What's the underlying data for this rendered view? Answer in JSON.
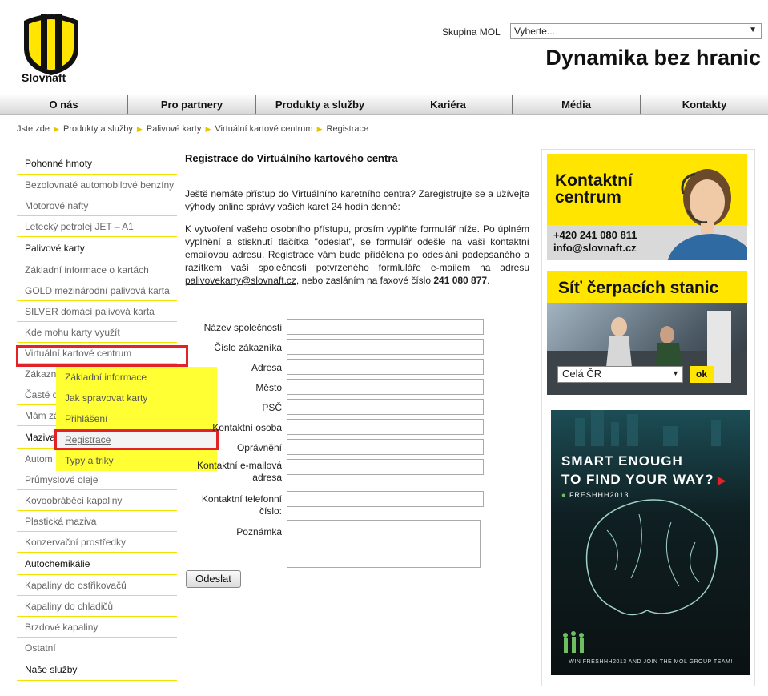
{
  "header": {
    "logo_text": "Slovnaft",
    "group_label": "Skupina MOL",
    "group_select_value": "Vyberte...",
    "slogan": "Dynamika bez hranic"
  },
  "topnav": [
    "O nás",
    "Pro partnery",
    "Produkty a služby",
    "Kariéra",
    "Média",
    "Kontakty"
  ],
  "breadcrumb": [
    "Jste zde",
    "Produkty a služby",
    "Palivové karty",
    "Virtuální kartové centrum",
    "Registrace"
  ],
  "sidebar": [
    {
      "label": "Pohonné hmoty",
      "cat": true
    },
    {
      "label": "Bezolovnaté automobilové benzíny",
      "cat": false
    },
    {
      "label": "Motorové nafty",
      "cat": false
    },
    {
      "label": "Letecký petrolej JET – A1",
      "cat": false
    },
    {
      "label": "Palivové karty",
      "cat": true
    },
    {
      "label": "Základní informace o kartách",
      "cat": false
    },
    {
      "label": "GOLD mezinárodní palivová karta",
      "cat": false
    },
    {
      "label": "SILVER domácí palivová karta",
      "cat": false
    },
    {
      "label": "Kde mohu karty využít",
      "cat": false
    },
    {
      "label": "Virtuální kartové centrum",
      "cat": false
    },
    {
      "label": "Zákazn",
      "cat": false
    },
    {
      "label": "Časté d",
      "cat": false
    },
    {
      "label": "Mám zá",
      "cat": false
    },
    {
      "label": "Maziva",
      "cat": true
    },
    {
      "label": "Autom",
      "cat": false
    },
    {
      "label": "Průmyslové oleje",
      "cat": false
    },
    {
      "label": "Kovoobráběcí kapaliny",
      "cat": false
    },
    {
      "label": "Plastická maziva",
      "cat": false
    },
    {
      "label": "Konzervační prostředky",
      "cat": false
    },
    {
      "label": "Autochemikálie",
      "cat": true
    },
    {
      "label": "Kapaliny do ostřikovačů",
      "cat": false
    },
    {
      "label": "Kapaliny do chladičů",
      "cat": false
    },
    {
      "label": "Brzdové kapaliny",
      "cat": false
    },
    {
      "label": "Ostatní",
      "cat": false
    },
    {
      "label": "Naše služby",
      "cat": true
    }
  ],
  "flyout": [
    "Základní informace",
    "Jak spravovat karty",
    "Přihlášení",
    "Registrace",
    "Typy a triky"
  ],
  "main": {
    "title": "Registrace do Virtuálního kartového centra",
    "intro": "Ještě nemáte přístup do Virtuálního karetního centra? Zaregistrujte se a užívejte výhody online správy vašich karet 24 hodin denně:",
    "instr_1": "K vytvoření vašeho osobního přístupu, prosím vyplňte formulář níže. Po úplném vyplnění a stisknutí tlačítka \"odeslat\", se formulář odešle na vaši kontaktní emailovou adresu. Registrace vám bude přidělena po odeslání podepsaného a razítkem vaší společnosti potvrzeného formluláře e-mailem na adresu ",
    "email": "palivovekarty@slovnaft.cz",
    "instr_2": ", nebo zasláním na faxové číslo ",
    "fax": "241 080 877",
    "instr_3": "."
  },
  "form": {
    "company": "Název společnosti",
    "customer_no": "Číslo zákazníka",
    "address": "Adresa",
    "city": "Město",
    "zip": "PSČ",
    "contact_person": "Kontaktní osoba",
    "authorization": "Oprávnění",
    "email": "Kontaktní e-mailová adresa",
    "phone": "Kontaktní telefonní číslo:",
    "note": "Poznámka",
    "submit": "Odeslat"
  },
  "contact": {
    "title": "Kontaktní centrum",
    "phone": "+420 241 080 811",
    "email": "info@slovnaft.cz"
  },
  "stations": {
    "title": "Síť čerpacích stanic",
    "select_value": "Celá ČR",
    "ok": "ok"
  },
  "ad": {
    "headline_1": "SMART ENOUGH",
    "headline_2": "TO FIND YOUR WAY?",
    "tag": "FRESHHH2013",
    "footer": "WIN FRESHHH2013 AND JOIN THE MOL GROUP TEAM!"
  }
}
